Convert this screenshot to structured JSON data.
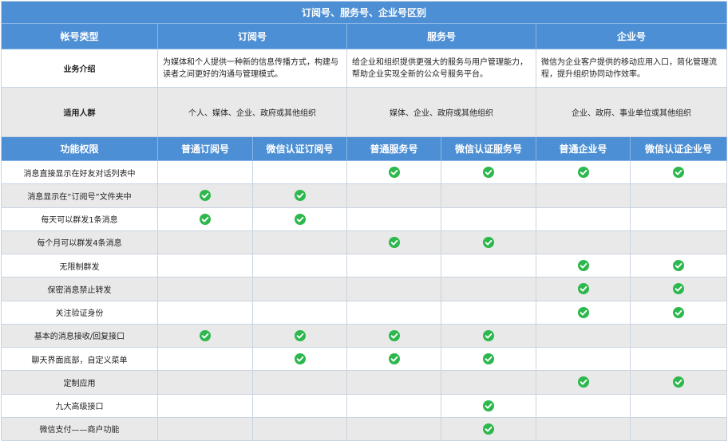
{
  "title": "订阅号、服务号、企业号区别",
  "header": {
    "col0": "帐号类型",
    "types": [
      "订阅号",
      "服务号",
      "企业号"
    ]
  },
  "intro": {
    "label": "业务介绍",
    "values": [
      "为媒体和个人提供一种新的信息传播方式，构建与读者之间更好的沟通与管理模式。",
      "给企业和组织提供更强大的服务与用户管理能力，帮助企业实现全新的公众号服务平台。",
      "微信为企业客户提供的移动应用入口，简化管理流程，提升组织协同动作效率。"
    ]
  },
  "audience": {
    "label": "适用人群",
    "values": [
      "个人、媒体、企业、政府或其他组织",
      "媒体、企业、政府或其他组织",
      "企业、政府、事业单位或其他组织"
    ]
  },
  "features_header": {
    "label": "功能权限",
    "columns": [
      "普通订阅号",
      "微信认证订阅号",
      "普通服务号",
      "微信认证服务号",
      "普通企业号",
      "微信认证企业号"
    ]
  },
  "check_icon": "check-circle-icon",
  "colors": {
    "header_bg": "#4d8fd4",
    "check": "#2db84d",
    "row_alt": "#e9e9e9"
  },
  "features": [
    {
      "name": "消息直接显示在好友对话列表中",
      "checks": [
        false,
        false,
        true,
        true,
        true,
        true
      ]
    },
    {
      "name": "消息显示在“订阅号”文件夹中",
      "checks": [
        true,
        true,
        false,
        false,
        false,
        false
      ]
    },
    {
      "name": "每天可以群发1条消息",
      "checks": [
        true,
        true,
        false,
        false,
        false,
        false
      ]
    },
    {
      "name": "每个月可以群发4条消息",
      "checks": [
        false,
        false,
        true,
        true,
        false,
        false
      ]
    },
    {
      "name": "无限制群发",
      "checks": [
        false,
        false,
        false,
        false,
        true,
        true
      ]
    },
    {
      "name": "保密消息禁止转发",
      "checks": [
        false,
        false,
        false,
        false,
        true,
        true
      ]
    },
    {
      "name": "关注验证身份",
      "checks": [
        false,
        false,
        false,
        false,
        true,
        true
      ]
    },
    {
      "name": "基本的消息接收/回复接口",
      "checks": [
        true,
        true,
        true,
        true,
        false,
        false
      ]
    },
    {
      "name": "聊天界面底部，自定义菜单",
      "checks": [
        false,
        true,
        true,
        true,
        false,
        false
      ]
    },
    {
      "name": "定制应用",
      "checks": [
        false,
        false,
        false,
        false,
        true,
        true
      ]
    },
    {
      "name": "九大高级接口",
      "checks": [
        false,
        false,
        false,
        true,
        false,
        false
      ]
    },
    {
      "name": "微信支付——商户功能",
      "checks": [
        false,
        false,
        false,
        true,
        false,
        false
      ]
    }
  ]
}
